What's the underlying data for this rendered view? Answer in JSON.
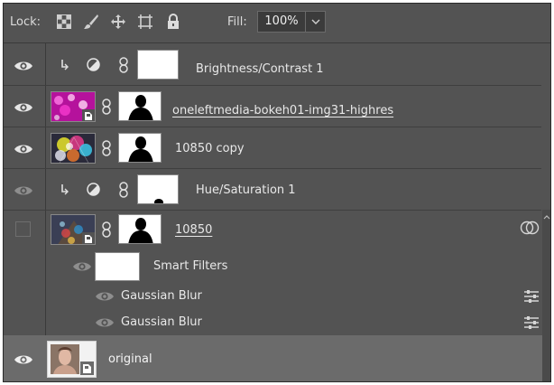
{
  "lockbar": {
    "lock_label": "Lock:",
    "fill_label": "Fill:",
    "fill_value": "100%"
  },
  "layers": [
    {
      "name": "Brightness/Contrast 1",
      "visible": true
    },
    {
      "name": "oneleftmedia-bokeh01-img31-highres",
      "visible": true
    },
    {
      "name": "10850 copy",
      "visible": true
    },
    {
      "name": "Hue/Saturation 1",
      "visible": true
    },
    {
      "name": "10850",
      "visible": false
    },
    {
      "name": "Smart Filters"
    },
    {
      "name": "Gaussian Blur"
    },
    {
      "name": "Gaussian Blur"
    },
    {
      "name": "original",
      "visible": true
    }
  ],
  "colors": {
    "panel_bg": "#535353",
    "selected_row": "#6b6b6b",
    "text": "#e8e8e8",
    "bokeh_magenta": "#d21ab4"
  }
}
